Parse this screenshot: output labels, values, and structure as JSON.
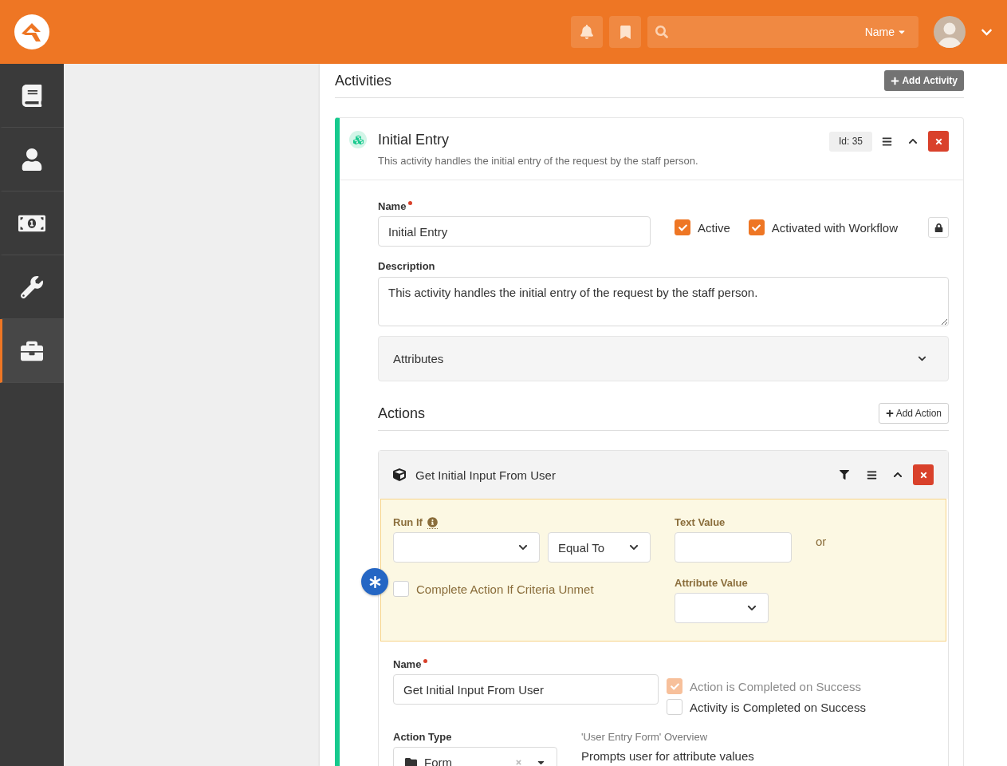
{
  "header": {
    "search_scope": "Name"
  },
  "sidebar": {
    "items": [
      {
        "selected": false
      },
      {
        "selected": false
      },
      {
        "selected": false
      },
      {
        "selected": false
      },
      {
        "selected": true
      }
    ]
  },
  "activities": {
    "title": "Activities",
    "add_button": "Add Activity",
    "activity": {
      "title": "Initial Entry",
      "description": "This activity handles the initial entry of the request by the staff person.",
      "id_badge": "Id: 35",
      "expanded": true,
      "name": {
        "label": "Name",
        "required": true,
        "value": "Initial Entry"
      },
      "flags": [
        {
          "label": "Active",
          "checked": true
        },
        {
          "label": "Activated with Workflow",
          "checked": true
        }
      ],
      "description_field": {
        "label": "Description",
        "value": "This activity handles the initial entry of the request by the staff person."
      },
      "attributes": {
        "title": "Attributes",
        "expanded": false
      },
      "actions": {
        "title": "Actions",
        "add_button": "Add Action",
        "items": [
          {
            "title": "Get Initial Input From User",
            "expanded": true,
            "criteria": {
              "run_if_label": "Run If",
              "operator": "Equal To",
              "text_value_label": "Text Value",
              "or_text": "or",
              "attribute_value_label": "Attribute Value",
              "complete_unmet": {
                "label": "Complete Action If Criteria Unmet",
                "checked": false
              }
            },
            "name": {
              "label": "Name",
              "required": true,
              "value": "Get Initial Input From User"
            },
            "flags": [
              {
                "label": "Action is Completed on Success",
                "checked": true,
                "disabled": true
              },
              {
                "label": "Activity is Completed on Success",
                "checked": false,
                "disabled": false
              }
            ],
            "action_type": {
              "label": "Action Type",
              "value": "Form"
            },
            "overview": {
              "title": "'User Entry Form' Overview",
              "text": "Prompts user for attribute values"
            }
          }
        ]
      }
    }
  }
}
